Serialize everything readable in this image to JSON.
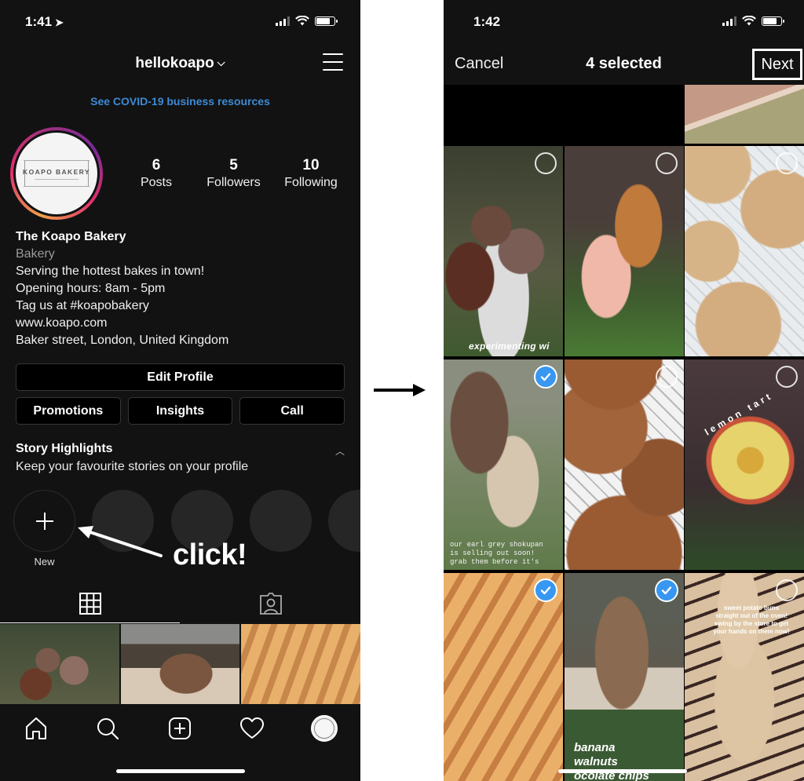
{
  "left_screen": {
    "status": {
      "time": "1:41",
      "location_icon": "location-arrow-icon"
    },
    "header": {
      "username": "hellokoapo",
      "menu_icon": "hamburger-menu-icon"
    },
    "covid_link": "See COVID-19 business resources",
    "avatar": {
      "logo_text": "KOAPO BAKERY"
    },
    "stats": [
      {
        "value": "6",
        "label": "Posts"
      },
      {
        "value": "5",
        "label": "Followers"
      },
      {
        "value": "10",
        "label": "Following"
      }
    ],
    "bio": {
      "name": "The Koapo Bakery",
      "category": "Bakery",
      "lines": [
        "Serving the hottest bakes in town!",
        "Opening hours: 8am - 5pm",
        "Tag us at #koapobakery",
        "www.koapo.com",
        "Baker street, London, United Kingdom"
      ]
    },
    "buttons": {
      "edit_profile": "Edit Profile",
      "promotions": "Promotions",
      "insights": "Insights",
      "call": "Call"
    },
    "story_highlights": {
      "title": "Story Highlights",
      "subtitle": "Keep your favourite stories on your profile",
      "new_label": "New"
    },
    "annotation": {
      "text": "click!"
    },
    "tabs": [
      {
        "name": "grid",
        "icon": "grid-icon",
        "active": true
      },
      {
        "name": "tagged",
        "icon": "tagged-person-icon",
        "active": false
      }
    ],
    "posts": [
      {
        "subject": "chocolate buns"
      },
      {
        "subject": "banana bread"
      },
      {
        "subject": "brioche loaf"
      }
    ],
    "nav": [
      "home-icon",
      "search-icon",
      "new-post-icon",
      "heart-icon",
      "profile-avatar-icon"
    ]
  },
  "right_screen": {
    "status": {
      "time": "1:42"
    },
    "picker": {
      "cancel": "Cancel",
      "title": "4 selected",
      "next": "Next"
    },
    "media": [
      {
        "id": "drink",
        "selected": false,
        "caption": ""
      },
      {
        "id": "muffins",
        "selected": false,
        "caption": "experimenting wi"
      },
      {
        "id": "croissant",
        "selected": false,
        "caption": ""
      },
      {
        "id": "cookies",
        "selected": false,
        "caption": ""
      },
      {
        "id": "shokupan",
        "selected": true,
        "caption": "our earl grey shokupan is selling out soon! grab them before it's"
      },
      {
        "id": "choc-cookies",
        "selected": false,
        "caption": ""
      },
      {
        "id": "lemon-tart",
        "selected": false,
        "caption": "lemon tart"
      },
      {
        "id": "brioche",
        "selected": true,
        "caption": ""
      },
      {
        "id": "banana-bread",
        "selected": true,
        "caption": "banana walnuts ocolate chips"
      },
      {
        "id": "sweet-potato-buns",
        "selected": false,
        "caption": "sweet potato buns straight out of the oven! swing by the store to get your hands on them now!"
      }
    ]
  },
  "colors": {
    "background": "#121212",
    "link_blue": "#3d8ad6",
    "check_blue": "#3897f0",
    "button_bg": "#000000",
    "button_border": "#363636"
  }
}
